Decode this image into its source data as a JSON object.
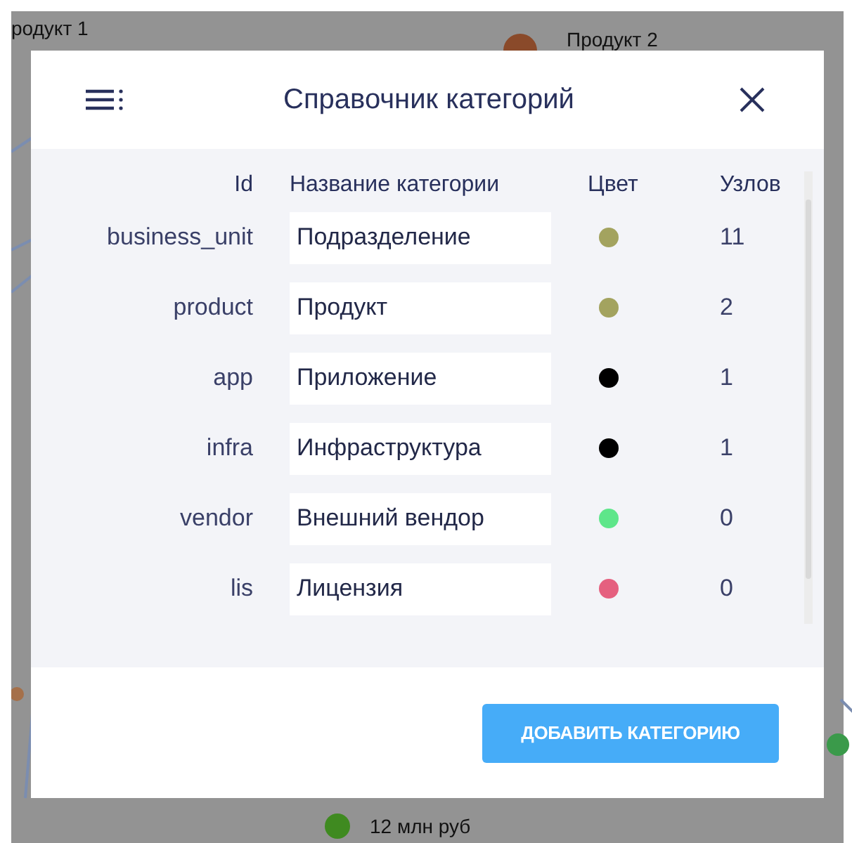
{
  "canvas": {
    "labels": [
      {
        "text": "родукт 1",
        "kind": "top-left"
      },
      {
        "text": "Продукт 2",
        "kind": "top-right"
      },
      {
        "text": "12 млн руб",
        "kind": "bottom"
      }
    ]
  },
  "dialog": {
    "title": "Справочник категорий",
    "columns": [
      "Id",
      "Название категории",
      "Цвет",
      "Узлов"
    ],
    "rows": [
      {
        "id": "business_unit",
        "name": "Подразделение",
        "color": "#a3a35f",
        "count": "11"
      },
      {
        "id": "product",
        "name": "Продукт",
        "color": "#a3a35f",
        "count": "2"
      },
      {
        "id": "app",
        "name": "Приложение",
        "color": "#000000",
        "count": "1"
      },
      {
        "id": "infra",
        "name": "Инфраструктура",
        "color": "#000000",
        "count": "1"
      },
      {
        "id": "vendor",
        "name": "Внешний вендор",
        "color": "#5ee68a",
        "count": "0"
      },
      {
        "id": "lis",
        "name": "Лицензия",
        "color": "#e5607f",
        "count": "0"
      }
    ],
    "button": "ДОБАВИТЬ КАТЕГОРИЮ"
  }
}
